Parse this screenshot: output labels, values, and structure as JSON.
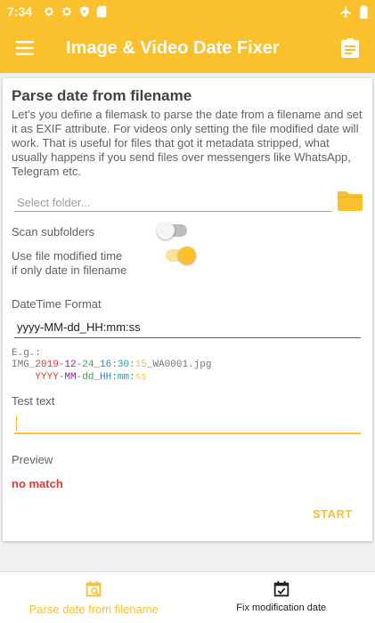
{
  "status_bar": {
    "time": "7:34",
    "left_icons": [
      "gear-icon",
      "gear-icon",
      "shield-icon",
      "sd-card-icon"
    ],
    "right_icons": [
      "airplane-icon",
      "battery-icon"
    ]
  },
  "app_bar": {
    "title": "Image & Video Date Fixer",
    "menu_icon": "hamburger-menu-icon",
    "action_icon": "clipboard-icon"
  },
  "card": {
    "title": "Parse date from filename",
    "description": "Let's you define a filemask to parse the date from a filename and set it as EXIF attribute. For videos only setting the file modified date will work. That is useful for files that got it metadata stripped, what usually happens if you send files over messengers like WhatsApp, Telegram etc.",
    "folder_placeholder": "Select folder...",
    "folder_icon": "folder-icon",
    "scan_subfolders_label": "Scan subfolders",
    "scan_subfolders_on": false,
    "use_modified_label_line1": "Use file modified time",
    "use_modified_label_line2": "if only date in filename",
    "use_modified_on": true,
    "datetime_format_label": "DateTime Format",
    "datetime_format_value": "yyyy-MM-dd_HH:mm:ss",
    "example": {
      "eg_label": "E.g.:",
      "prefix": "IMG_",
      "year": "2019",
      "sep1": "-",
      "month": "12",
      "sep2": "-",
      "day": "24",
      "sep3": "_",
      "hour": "16",
      "sep4": ":",
      "minute": "30",
      "sep5": ":",
      "second": "15",
      "suffix": "_WA0001.jpg",
      "mask_indent": "    ",
      "mask_year": "YYYY",
      "mask_month": "MM",
      "mask_day": "dd",
      "mask_hour": "HH",
      "mask_minute": "mm",
      "mask_second": "ss"
    },
    "test_text_label": "Test text",
    "test_text_value": "",
    "preview_label": "Preview",
    "preview_value": "no match",
    "start_label": "START"
  },
  "bottom_nav": {
    "items": [
      {
        "label": "Parse date from filename",
        "icon": "calendar-search-icon",
        "active": true
      },
      {
        "label": "Fix modification date",
        "icon": "calendar-check-icon",
        "active": false
      }
    ]
  },
  "colors": {
    "accent": "#fbc02d",
    "error": "#e53935"
  }
}
